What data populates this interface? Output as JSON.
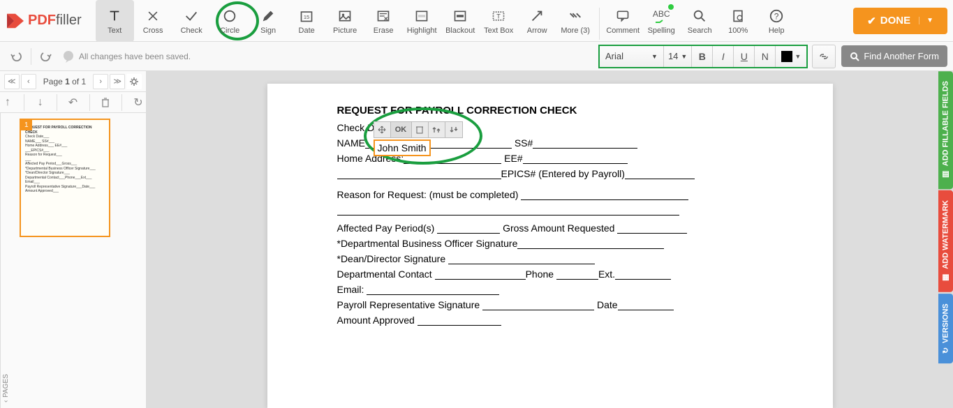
{
  "logo": {
    "pdf": "PDF",
    "filler": "filler"
  },
  "tools": {
    "text": "Text",
    "cross": "Cross",
    "check": "Check",
    "circle": "Circle",
    "sign": "Sign",
    "date": "Date",
    "picture": "Picture",
    "erase": "Erase",
    "highlight": "Highlight",
    "blackout": "Blackout",
    "textbox": "Text Box",
    "arrow": "Arrow",
    "more": "More (3)",
    "comment": "Comment",
    "spelling": "Spelling",
    "search": "Search",
    "zoom": "100%",
    "help": "Help"
  },
  "done_label": "DONE",
  "saved_msg": "All changes have been saved.",
  "font": {
    "name": "Arial",
    "size": "14"
  },
  "fmt": {
    "bold": "B",
    "italic": "I",
    "underline": "U",
    "normal": "N"
  },
  "find_label": "Find Another Form",
  "page_nav": {
    "label_pre": "Page ",
    "current": "1",
    "label_mid": " of ",
    "total": "1"
  },
  "pages_label": "PAGES",
  "rail": {
    "fillable": "ADD FILLABLE FIELDS",
    "watermark": "ADD WATERMARK",
    "versions": "VERSIONS"
  },
  "doc": {
    "title": "REQUEST FOR PAYROLL CORRECTION CHECK",
    "check_date": "Check D",
    "name": "NAME",
    "ss": "SS#",
    "home": "Home Address:",
    "ee": "EE#",
    "epics": "EPICS# (Entered by Payroll)",
    "reason": "Reason for Request: (must be completed)",
    "affected": "Affected Pay Period(s)",
    "gross": "Gross Amount Requested",
    "dept_sig": "*Departmental Business Officer Signature",
    "dean_sig": "*Dean/Director Signature",
    "dept_contact": "Departmental Contact",
    "phone": "Phone",
    "ext": "Ext.",
    "email": "Email:",
    "payroll_sig": "Payroll Representative Signature",
    "date": "Date",
    "amount": "Amount Approved"
  },
  "edit": {
    "ok": "OK",
    "value": "John Smith"
  }
}
